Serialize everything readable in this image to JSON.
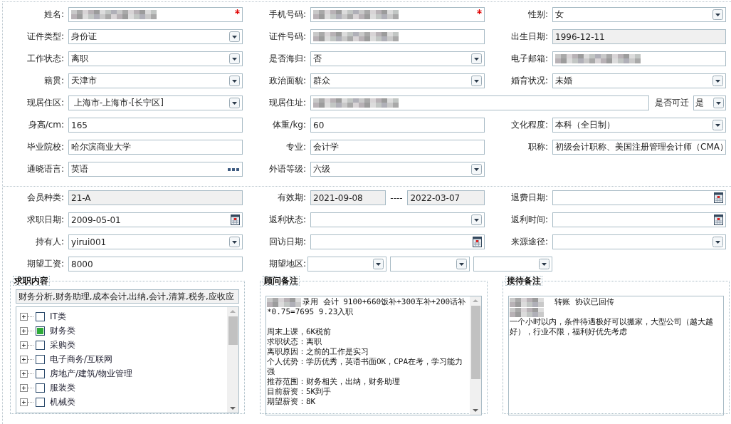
{
  "personal_rows": [
    {
      "cells": [
        {
          "label": "姓名:",
          "kind": "text",
          "redacted": true,
          "required": true
        },
        {
          "label": "手机号码:",
          "kind": "text",
          "redacted": true,
          "required": true
        },
        {
          "label": "性别:",
          "kind": "select",
          "value": "女"
        }
      ]
    },
    {
      "cells": [
        {
          "label": "证件类型:",
          "kind": "select",
          "value": "身份证"
        },
        {
          "label": "证件号码:",
          "kind": "text",
          "redacted": true
        },
        {
          "label": "出生日期:",
          "kind": "text",
          "value": "1996-12-11",
          "readonly": true
        }
      ]
    },
    {
      "cells": [
        {
          "label": "工作状态:",
          "kind": "select",
          "value": "离职"
        },
        {
          "label": "是否海归:",
          "kind": "select",
          "value": "否"
        },
        {
          "label": "电子邮箱:",
          "kind": "text",
          "redacted": true
        }
      ]
    },
    {
      "cells": [
        {
          "label": "籍贯:",
          "kind": "select",
          "value": "天津市"
        },
        {
          "label": "政治面貌:",
          "kind": "select",
          "value": "群众"
        },
        {
          "label": "婚育状况:",
          "kind": "select",
          "value": "未婚"
        }
      ]
    },
    {
      "cells": [
        {
          "label": "现居住区:",
          "kind": "select",
          "value": " 上海市-上海市-[长宁区]"
        },
        {
          "label": "现居住址:",
          "kind": "text",
          "redacted": true,
          "extra": {
            "label": "是否可迁",
            "kind": "select",
            "value": "是"
          }
        }
      ]
    },
    {
      "cells": [
        {
          "label": "身高/cm:",
          "kind": "text",
          "value": "165"
        },
        {
          "label": "体重/kg:",
          "kind": "text",
          "value": "60"
        },
        {
          "label": "文化程度:",
          "kind": "select",
          "value": "本科（全日制）"
        }
      ]
    },
    {
      "cells": [
        {
          "label": "毕业院校:",
          "kind": "text",
          "value": "哈尔滨商业大学"
        },
        {
          "label": "专业:",
          "kind": "text",
          "value": "会计学"
        },
        {
          "label": "职称:",
          "kind": "text",
          "value": "初级会计职称、美国注册管理会计师（CMA）"
        }
      ]
    },
    {
      "cells": [
        {
          "label": "通晓语言:",
          "kind": "picker",
          "value": "英语"
        },
        {
          "label": "外语等级:",
          "kind": "select",
          "value": "六级"
        }
      ]
    }
  ],
  "membership_rows": [
    {
      "cells": [
        {
          "label": "会员种类:",
          "kind": "text",
          "value": "21-A",
          "readonly": true
        },
        {
          "label": "有效期:",
          "kind": "range",
          "readonly": true,
          "from": "2021-09-08",
          "separator": "----",
          "to": "2022-03-07"
        },
        {
          "label": "退费日期:",
          "kind": "date"
        }
      ]
    },
    {
      "cells": [
        {
          "label": "求职日期:",
          "kind": "date",
          "value": "2009-05-01"
        },
        {
          "label": "返利状态:",
          "kind": "select"
        },
        {
          "label": "返利时间:",
          "kind": "date"
        }
      ]
    },
    {
      "cells": [
        {
          "label": "持有人:",
          "kind": "select",
          "value": "yirui001"
        },
        {
          "label": "回访日期:",
          "kind": "date"
        },
        {
          "label": "来源途径:",
          "kind": "select"
        }
      ]
    },
    {
      "cells": [
        {
          "label": "期望工资:",
          "kind": "text",
          "value": "8000"
        },
        {
          "label": "期望地区:",
          "kind": "multi",
          "fields": [
            {
              "kind": "select"
            },
            {
              "kind": "select"
            },
            {
              "kind": "select"
            }
          ]
        }
      ]
    }
  ],
  "job_content": {
    "title": "求职内容",
    "value": "财务分析,财务助理,成本会计,出纳,会计,清算,税务,应收应",
    "tree": [
      {
        "label": "IT类",
        "checked": false
      },
      {
        "label": "财务类",
        "checked": true
      },
      {
        "label": "采购类",
        "checked": false
      },
      {
        "label": "电子商务/互联网",
        "checked": false
      },
      {
        "label": "房地产/建筑/物业管理",
        "checked": false
      },
      {
        "label": "服装类",
        "checked": false
      },
      {
        "label": "机械类",
        "checked": false
      }
    ]
  },
  "notes": [
    {
      "title": "顾问备注",
      "scrollbar": true,
      "lines": [
        {
          "redacted": true,
          "text": "录用 会计 9100+660饭补+300车补+200话补"
        },
        {
          "text": "*0.75=7695 9.23入职"
        },
        {
          "text": "周末上课，6K税前",
          "space_before": true
        },
        {
          "text": "求职状态：离职"
        },
        {
          "text": "离职原因：之前的工作是实习"
        },
        {
          "text": "个人优势：学历优秀，英语书面OK，CPA在考，学习能力强"
        },
        {
          "text": "推荐范围：财务相关，出纳，财务助理"
        },
        {
          "text": "目前薪资：5K到手"
        },
        {
          "text": "期望薪资：8K"
        }
      ]
    },
    {
      "title": "接待备注",
      "scrollbar": false,
      "lines": [
        {
          "redacted": true,
          "text": "  转账 协议已回传"
        },
        {
          "redacted": true
        },
        {
          "text": "一个小时以内，条件待遇极好可以搬家，大型公司（越大越好），行业不限，福利好优先考虑"
        }
      ]
    }
  ]
}
